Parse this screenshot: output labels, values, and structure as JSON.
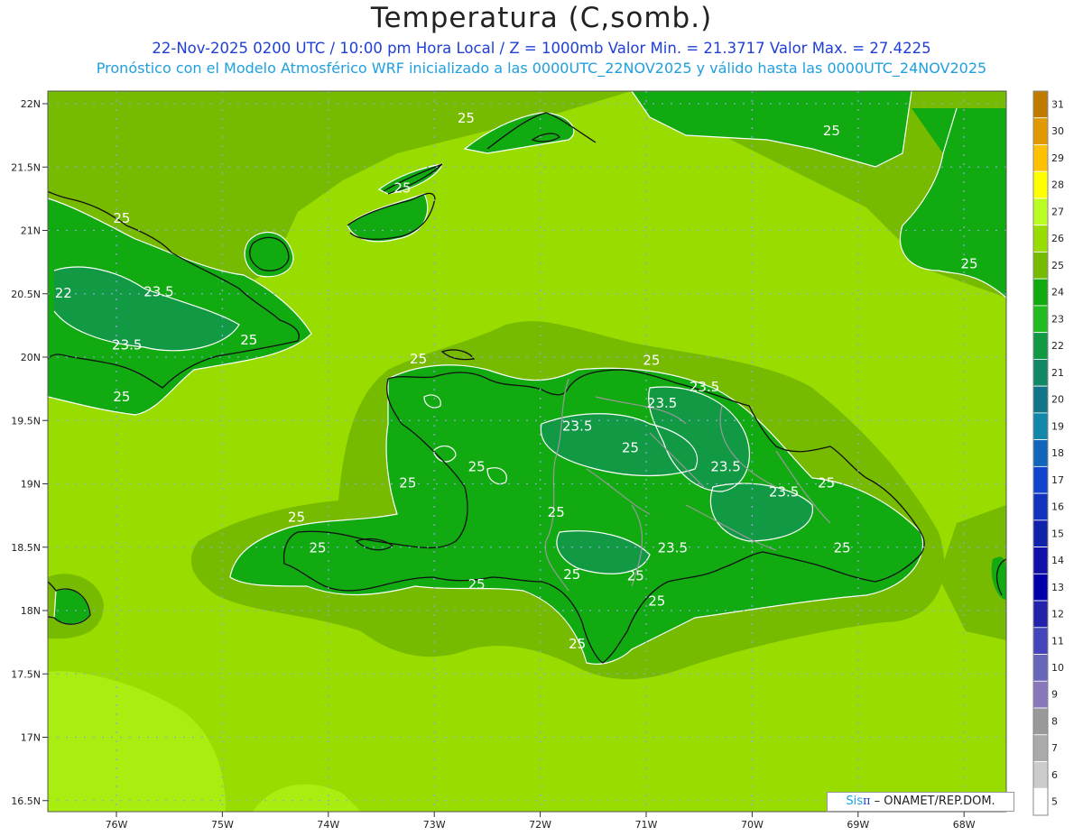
{
  "header": {
    "title": "Temperatura (C,somb.)",
    "line1": "22-Nov-2025 0200 UTC / 10:00 pm Hora Local / Z = 1000mb  Valor Min. = 21.3717  Valor Max. = 27.4225",
    "line2": "Pronóstico con el Modelo Atmosférico WRF inicializado a las 0000UTC_22NOV2025 y válido hasta las  0000UTC_24NOV2025"
  },
  "axes": {
    "lat_labels": [
      "22N",
      "21.5N",
      "21N",
      "20.5N",
      "20N",
      "19.5N",
      "19N",
      "18.5N",
      "18N",
      "17.5N",
      "17N",
      "16.5N"
    ],
    "lon_labels": [
      "76W",
      "75W",
      "74W",
      "73W",
      "72W",
      "71W",
      "70W",
      "69W",
      "68W"
    ]
  },
  "colorbar": {
    "labels": [
      "31",
      "30",
      "29",
      "28",
      "27",
      "26",
      "25",
      "24",
      "23",
      "22",
      "21",
      "20",
      "19",
      "18",
      "17",
      "16",
      "15",
      "14",
      "13",
      "12",
      "11",
      "10",
      "9",
      "8",
      "7",
      "6",
      "5"
    ],
    "colors": [
      "#c07a00",
      "#e09a00",
      "#ffc000",
      "#ffff00",
      "#bbff22",
      "#99dd00",
      "#77bb00",
      "#11aa11",
      "#22bb22",
      "#119944",
      "#118866",
      "#117788",
      "#1188aa",
      "#1166bb",
      "#1144cc",
      "#1133bb",
      "#1122aa",
      "#1111aa",
      "#0000aa",
      "#2222aa",
      "#4444bb",
      "#6666bb",
      "#8877bb",
      "#999999",
      "#aaaaaa",
      "#cccccc",
      "#ffffff"
    ]
  },
  "field_colors": {
    "lt_yellow_green": "#aaee11",
    "yellow_green": "#99dd00",
    "green_mid": "#77bb00",
    "green_land": "#11aa11",
    "green_dark": "#119944"
  },
  "contour_labels": [
    {
      "text": "25",
      "lon": -73.3,
      "lat": 21.3
    },
    {
      "text": "25",
      "lon": -72.7,
      "lat": 21.85
    },
    {
      "text": "25",
      "lon": -69.25,
      "lat": 21.75
    },
    {
      "text": "25",
      "lon": -67.95,
      "lat": 20.7
    },
    {
      "text": "25",
      "lon": -75.95,
      "lat": 21.06
    },
    {
      "text": "22",
      "lon": -76.5,
      "lat": 20.47
    },
    {
      "text": "23.5",
      "lon": -75.6,
      "lat": 20.48
    },
    {
      "text": "25",
      "lon": -74.75,
      "lat": 20.1
    },
    {
      "text": "23.5",
      "lon": -75.9,
      "lat": 20.06
    },
    {
      "text": "25",
      "lon": -75.95,
      "lat": 19.65
    },
    {
      "text": "25",
      "lon": -73.15,
      "lat": 19.95
    },
    {
      "text": "25",
      "lon": -70.95,
      "lat": 19.94
    },
    {
      "text": "23.5",
      "lon": -70.45,
      "lat": 19.73
    },
    {
      "text": "23.5",
      "lon": -70.85,
      "lat": 19.6
    },
    {
      "text": "23.5",
      "lon": -71.65,
      "lat": 19.42
    },
    {
      "text": "25",
      "lon": -71.15,
      "lat": 19.25
    },
    {
      "text": "25",
      "lon": -72.6,
      "lat": 19.1
    },
    {
      "text": "25",
      "lon": -73.25,
      "lat": 18.97
    },
    {
      "text": "23.5",
      "lon": -70.25,
      "lat": 19.1
    },
    {
      "text": "23.5",
      "lon": -69.7,
      "lat": 18.9
    },
    {
      "text": "25",
      "lon": -69.3,
      "lat": 18.97
    },
    {
      "text": "25",
      "lon": -74.3,
      "lat": 18.7
    },
    {
      "text": "25",
      "lon": -74.1,
      "lat": 18.46
    },
    {
      "text": "25",
      "lon": -71.85,
      "lat": 18.74
    },
    {
      "text": "23.5",
      "lon": -70.75,
      "lat": 18.46
    },
    {
      "text": "25",
      "lon": -71.7,
      "lat": 18.25
    },
    {
      "text": "25",
      "lon": -71.1,
      "lat": 18.24
    },
    {
      "text": "25",
      "lon": -72.6,
      "lat": 18.17
    },
    {
      "text": "25",
      "lon": -69.15,
      "lat": 18.46
    },
    {
      "text": "25",
      "lon": -70.9,
      "lat": 18.04
    },
    {
      "text": "25",
      "lon": -71.65,
      "lat": 17.7
    }
  ],
  "credit": {
    "brand": "Sis",
    "pi": "π",
    "rest": " – ONAMET/REP.DOM."
  }
}
